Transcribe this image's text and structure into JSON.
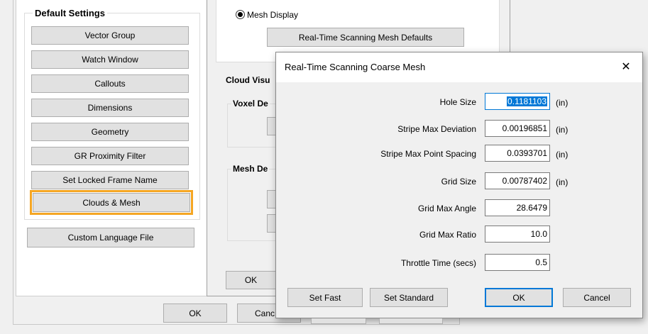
{
  "left_panel": {
    "group_title": "Default Settings",
    "buttons": [
      "Vector Group",
      "Watch Window",
      "Callouts",
      "Dimensions",
      "Geometry",
      "GR Proximity Filter",
      "Set Locked Frame Name",
      "Clouds & Mesh"
    ],
    "custom_language": "Custom Language File",
    "ok": "OK",
    "cancel": "Canc"
  },
  "middle_panel": {
    "mesh_display": "Mesh Display",
    "mesh_defaults_button": "Real-Time Scanning Mesh Defaults",
    "cloud_vis": "Cloud Visu",
    "voxel": "Voxel De",
    "mesh_de": "Mesh De",
    "ok": "OK"
  },
  "dialog": {
    "title": "Real-Time Scanning Coarse Mesh",
    "close": "✕",
    "fields": [
      {
        "label": "Hole Size",
        "value": "0.1181103",
        "unit": "(in)"
      },
      {
        "label": "Stripe Max Deviation",
        "value": "0.00196851",
        "unit": "(in)"
      },
      {
        "label": "Stripe Max Point Spacing",
        "value": "0.0393701",
        "unit": "(in)"
      },
      {
        "label": "Grid Size",
        "value": "0.00787402",
        "unit": "(in)"
      },
      {
        "label": "Grid Max Angle",
        "value": "28.6479",
        "unit": ""
      },
      {
        "label": "Grid Max Ratio",
        "value": "10.0",
        "unit": ""
      },
      {
        "label": "Throttle Time (secs)",
        "value": "0.5",
        "unit": ""
      }
    ],
    "set_fast": "Set Fast",
    "set_standard": "Set Standard",
    "ok": "OK",
    "cancel": "Cancel"
  },
  "colors": {
    "highlight": "#f5a623",
    "selection": "#0078d7"
  }
}
